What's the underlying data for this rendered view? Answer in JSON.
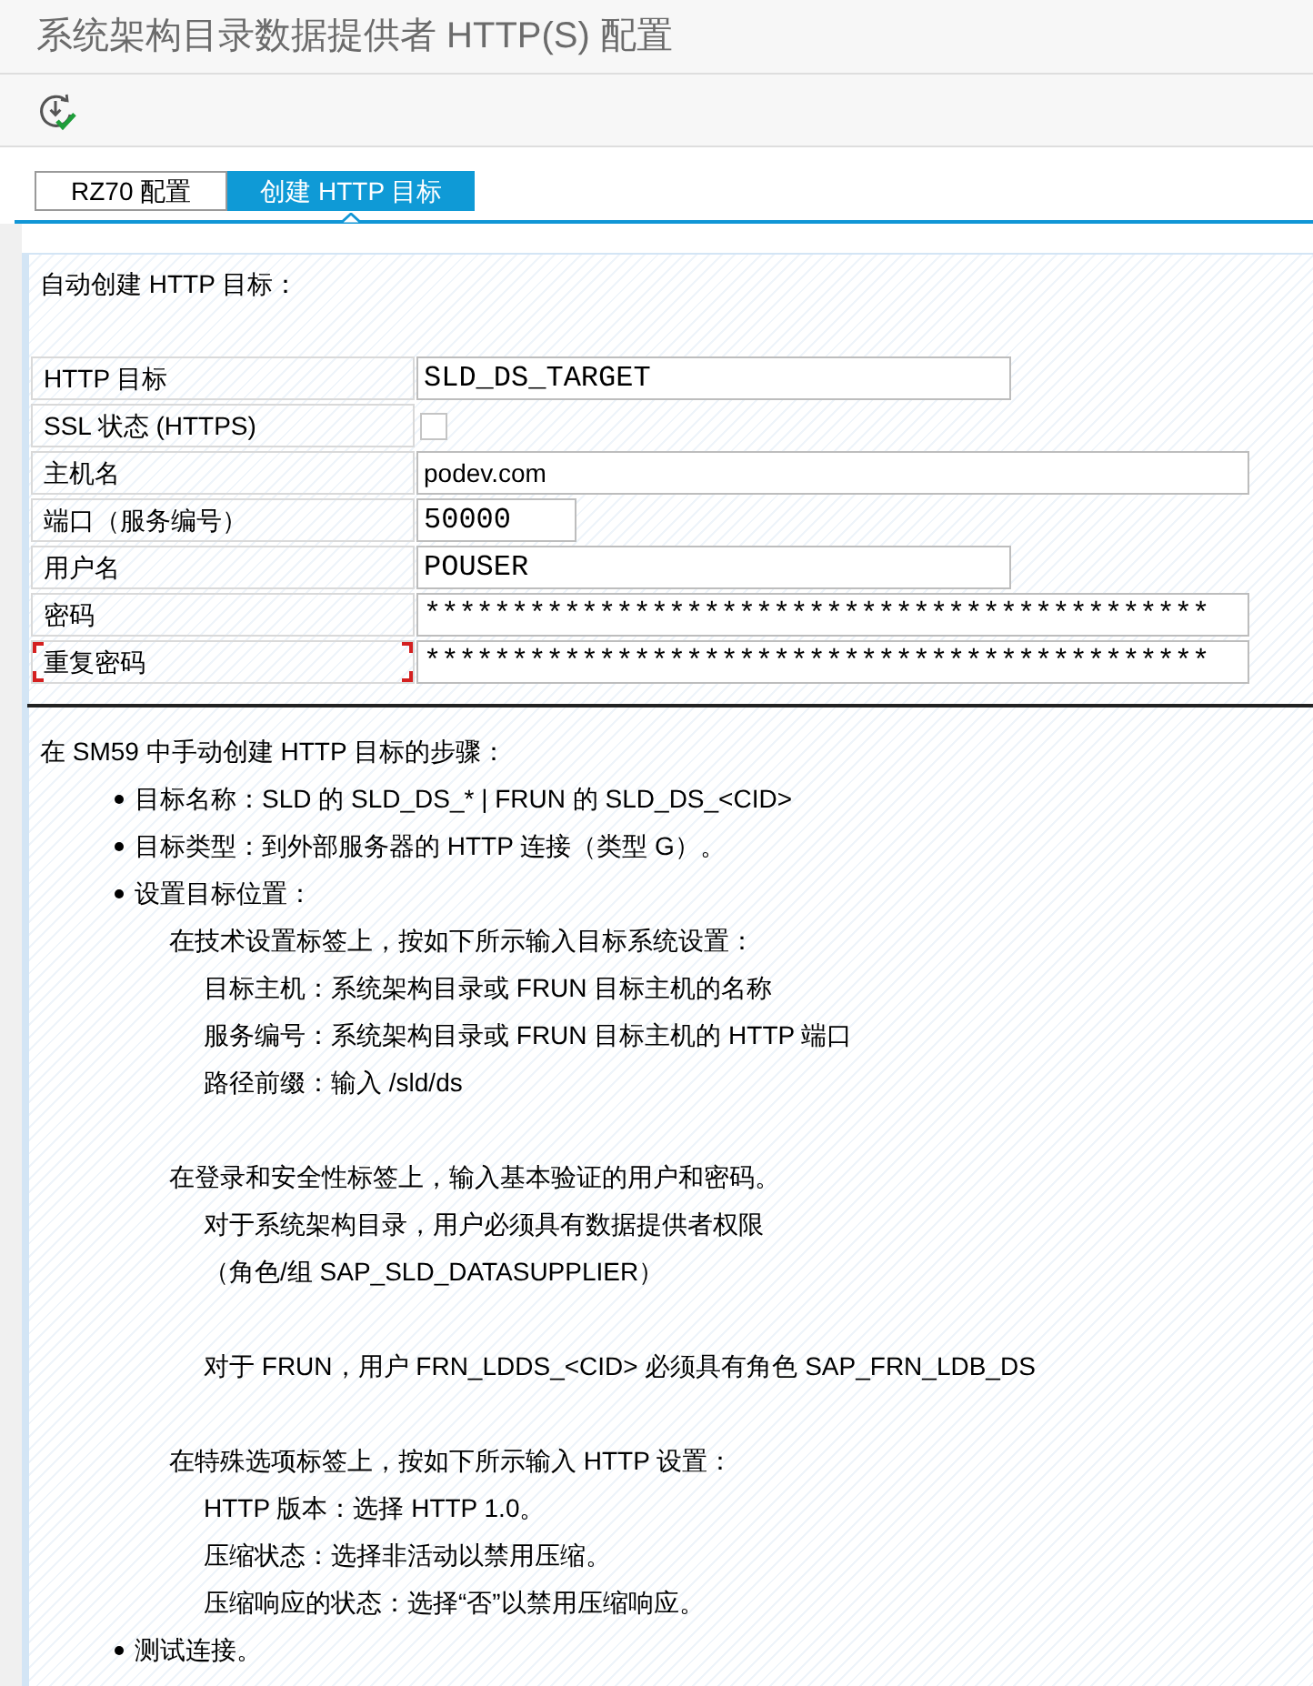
{
  "window": {
    "title": "系统架构目录数据提供者 HTTP(S) 配置"
  },
  "tabs": [
    {
      "label": "RZ70 配置",
      "selected": false
    },
    {
      "label": "创建 HTTP 目标",
      "selected": true
    }
  ],
  "form": {
    "heading": "自动创建 HTTP 目标：",
    "fields": [
      {
        "label": "HTTP 目标",
        "kind": "text",
        "value": "SLD_DS_TARGET",
        "focused": false
      },
      {
        "label": "SSL 状态 (HTTPS)",
        "kind": "checkbox",
        "checked": false,
        "focused": false
      },
      {
        "label": "主机名",
        "kind": "text",
        "value": "podev.com",
        "focused": false
      },
      {
        "label": "端口（服务编号）",
        "kind": "text",
        "value": "50000",
        "focused": false
      },
      {
        "label": "用户名",
        "kind": "text",
        "value": "POUSER",
        "focused": false
      },
      {
        "label": "密码",
        "kind": "password",
        "value": "*********************************************",
        "focused": false
      },
      {
        "label": "重复密码",
        "kind": "password",
        "value": "*********************************************",
        "focused": true
      }
    ]
  },
  "instructions": {
    "heading": "在 SM59 中手动创建 HTTP 目标的步骤：",
    "items": [
      {
        "text": "目标名称：SLD 的 SLD_DS_* | FRUN 的 SLD_DS_<CID>"
      },
      {
        "text": "目标类型：到外部服务器的 HTTP 连接（类型 G）。"
      },
      {
        "text": "设置目标位置：",
        "children": [
          {
            "text": "在技术设置标签上，按如下所示输入目标系统设置：",
            "blocks": [
              [
                "目标主机：系统架构目录或 FRUN 目标主机的名称",
                "服务编号：系统架构目录或 FRUN 目标主机的 HTTP 端口",
                "路径前缀：输入 /sld/ds"
              ]
            ]
          },
          {
            "text": "在登录和安全性标签上，输入基本验证的用户和密码。",
            "blocks": [
              [
                "对于系统架构目录，用户必须具有数据提供者权限",
                "（角色/组 SAP_SLD_DATASUPPLIER）"
              ],
              [
                "对于 FRUN，用户 FRN_LDDS_<CID> 必须具有角色 SAP_FRN_LDB_DS"
              ]
            ]
          },
          {
            "text": "在特殊选项标签上，按如下所示输入 HTTP 设置：",
            "blocks": [
              [
                "HTTP 版本：选择 HTTP 1.0。",
                "压缩状态：选择非活动以禁用压缩。",
                "压缩响应的状态：选择“否”以禁用压缩响应。"
              ]
            ]
          }
        ]
      },
      {
        "text": "测试连接。"
      }
    ]
  }
}
